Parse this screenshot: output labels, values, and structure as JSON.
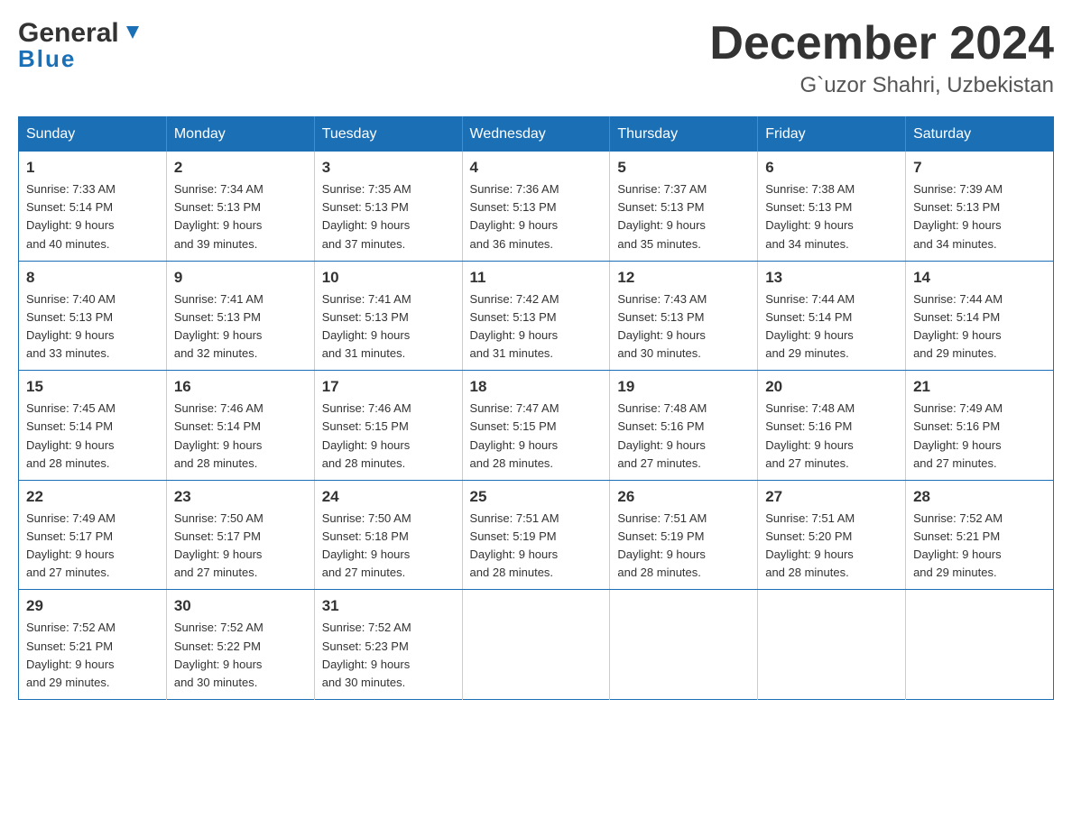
{
  "header": {
    "logo": {
      "line1": "General",
      "line2": "Blue"
    },
    "title": "December 2024",
    "subtitle": "G`uzor Shahri, Uzbekistan"
  },
  "columns": [
    "Sunday",
    "Monday",
    "Tuesday",
    "Wednesday",
    "Thursday",
    "Friday",
    "Saturday"
  ],
  "weeks": [
    [
      {
        "day": "1",
        "sunrise": "7:33 AM",
        "sunset": "5:14 PM",
        "daylight": "9 hours and 40 minutes."
      },
      {
        "day": "2",
        "sunrise": "7:34 AM",
        "sunset": "5:13 PM",
        "daylight": "9 hours and 39 minutes."
      },
      {
        "day": "3",
        "sunrise": "7:35 AM",
        "sunset": "5:13 PM",
        "daylight": "9 hours and 37 minutes."
      },
      {
        "day": "4",
        "sunrise": "7:36 AM",
        "sunset": "5:13 PM",
        "daylight": "9 hours and 36 minutes."
      },
      {
        "day": "5",
        "sunrise": "7:37 AM",
        "sunset": "5:13 PM",
        "daylight": "9 hours and 35 minutes."
      },
      {
        "day": "6",
        "sunrise": "7:38 AM",
        "sunset": "5:13 PM",
        "daylight": "9 hours and 34 minutes."
      },
      {
        "day": "7",
        "sunrise": "7:39 AM",
        "sunset": "5:13 PM",
        "daylight": "9 hours and 34 minutes."
      }
    ],
    [
      {
        "day": "8",
        "sunrise": "7:40 AM",
        "sunset": "5:13 PM",
        "daylight": "9 hours and 33 minutes."
      },
      {
        "day": "9",
        "sunrise": "7:41 AM",
        "sunset": "5:13 PM",
        "daylight": "9 hours and 32 minutes."
      },
      {
        "day": "10",
        "sunrise": "7:41 AM",
        "sunset": "5:13 PM",
        "daylight": "9 hours and 31 minutes."
      },
      {
        "day": "11",
        "sunrise": "7:42 AM",
        "sunset": "5:13 PM",
        "daylight": "9 hours and 31 minutes."
      },
      {
        "day": "12",
        "sunrise": "7:43 AM",
        "sunset": "5:13 PM",
        "daylight": "9 hours and 30 minutes."
      },
      {
        "day": "13",
        "sunrise": "7:44 AM",
        "sunset": "5:14 PM",
        "daylight": "9 hours and 29 minutes."
      },
      {
        "day": "14",
        "sunrise": "7:44 AM",
        "sunset": "5:14 PM",
        "daylight": "9 hours and 29 minutes."
      }
    ],
    [
      {
        "day": "15",
        "sunrise": "7:45 AM",
        "sunset": "5:14 PM",
        "daylight": "9 hours and 28 minutes."
      },
      {
        "day": "16",
        "sunrise": "7:46 AM",
        "sunset": "5:14 PM",
        "daylight": "9 hours and 28 minutes."
      },
      {
        "day": "17",
        "sunrise": "7:46 AM",
        "sunset": "5:15 PM",
        "daylight": "9 hours and 28 minutes."
      },
      {
        "day": "18",
        "sunrise": "7:47 AM",
        "sunset": "5:15 PM",
        "daylight": "9 hours and 28 minutes."
      },
      {
        "day": "19",
        "sunrise": "7:48 AM",
        "sunset": "5:16 PM",
        "daylight": "9 hours and 27 minutes."
      },
      {
        "day": "20",
        "sunrise": "7:48 AM",
        "sunset": "5:16 PM",
        "daylight": "9 hours and 27 minutes."
      },
      {
        "day": "21",
        "sunrise": "7:49 AM",
        "sunset": "5:16 PM",
        "daylight": "9 hours and 27 minutes."
      }
    ],
    [
      {
        "day": "22",
        "sunrise": "7:49 AM",
        "sunset": "5:17 PM",
        "daylight": "9 hours and 27 minutes."
      },
      {
        "day": "23",
        "sunrise": "7:50 AM",
        "sunset": "5:17 PM",
        "daylight": "9 hours and 27 minutes."
      },
      {
        "day": "24",
        "sunrise": "7:50 AM",
        "sunset": "5:18 PM",
        "daylight": "9 hours and 27 minutes."
      },
      {
        "day": "25",
        "sunrise": "7:51 AM",
        "sunset": "5:19 PM",
        "daylight": "9 hours and 28 minutes."
      },
      {
        "day": "26",
        "sunrise": "7:51 AM",
        "sunset": "5:19 PM",
        "daylight": "9 hours and 28 minutes."
      },
      {
        "day": "27",
        "sunrise": "7:51 AM",
        "sunset": "5:20 PM",
        "daylight": "9 hours and 28 minutes."
      },
      {
        "day": "28",
        "sunrise": "7:52 AM",
        "sunset": "5:21 PM",
        "daylight": "9 hours and 29 minutes."
      }
    ],
    [
      {
        "day": "29",
        "sunrise": "7:52 AM",
        "sunset": "5:21 PM",
        "daylight": "9 hours and 29 minutes."
      },
      {
        "day": "30",
        "sunrise": "7:52 AM",
        "sunset": "5:22 PM",
        "daylight": "9 hours and 30 minutes."
      },
      {
        "day": "31",
        "sunrise": "7:52 AM",
        "sunset": "5:23 PM",
        "daylight": "9 hours and 30 minutes."
      },
      null,
      null,
      null,
      null
    ]
  ],
  "labels": {
    "sunrise_prefix": "Sunrise: ",
    "sunset_prefix": "Sunset: ",
    "daylight_prefix": "Daylight: "
  }
}
